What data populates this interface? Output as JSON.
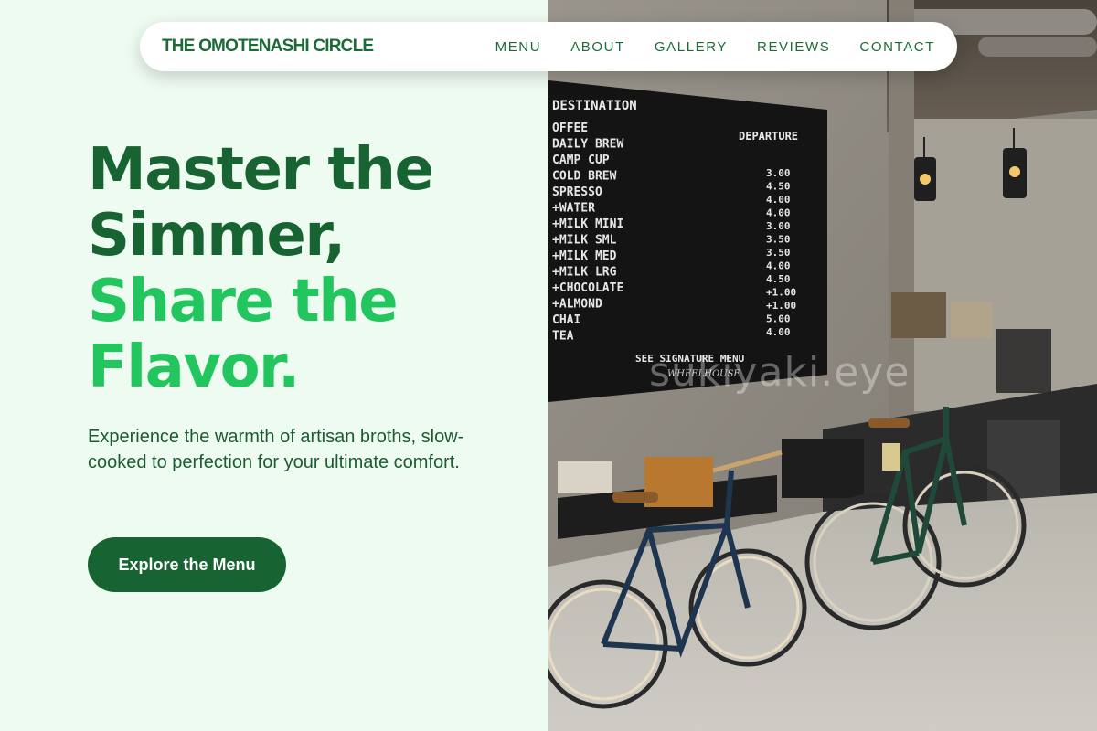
{
  "nav": {
    "brand": "THE OMOTENASHI CIRCLE",
    "links": [
      "MENU",
      "ABOUT",
      "GALLERY",
      "REVIEWS",
      "CONTACT"
    ]
  },
  "hero": {
    "headline_dark_1": "Master the",
    "headline_dark_2": "Simmer,",
    "headline_light_1": "Share the",
    "headline_light_2": "Flavor.",
    "subtext": "Experience the warmth of artisan broths, slow-cooked to perfection for your ultimate comfort.",
    "cta_label": "Explore the Menu"
  },
  "photo": {
    "board_title": "DESTINATION",
    "board_departure": "DEPARTURE",
    "board_items": [
      "OFFEE",
      "DAILY BREW",
      "CAMP CUP",
      "COLD BREW",
      "SPRESSO",
      "+WATER",
      "+MILK  MINI",
      "+MILK  SML",
      "+MILK  MED",
      "+MILK  LRG",
      "+CHOCOLATE",
      "+ALMOND",
      "CHAI",
      "TEA"
    ],
    "board_prices": [
      "3.00",
      "4.50",
      "4.00",
      "4.00",
      "3.00",
      "3.50",
      "3.50",
      "4.00",
      "4.50",
      "+1.00",
      "+1.00",
      "5.00",
      "4.00"
    ],
    "board_footer": "SEE SIGNATURE MENU",
    "board_sign": "WHEELHOUSE",
    "watermark": "sukiyaki.eye"
  },
  "colors": {
    "background": "#eefbf1",
    "primary_dark": "#186332",
    "accent_green": "#22c55e"
  }
}
